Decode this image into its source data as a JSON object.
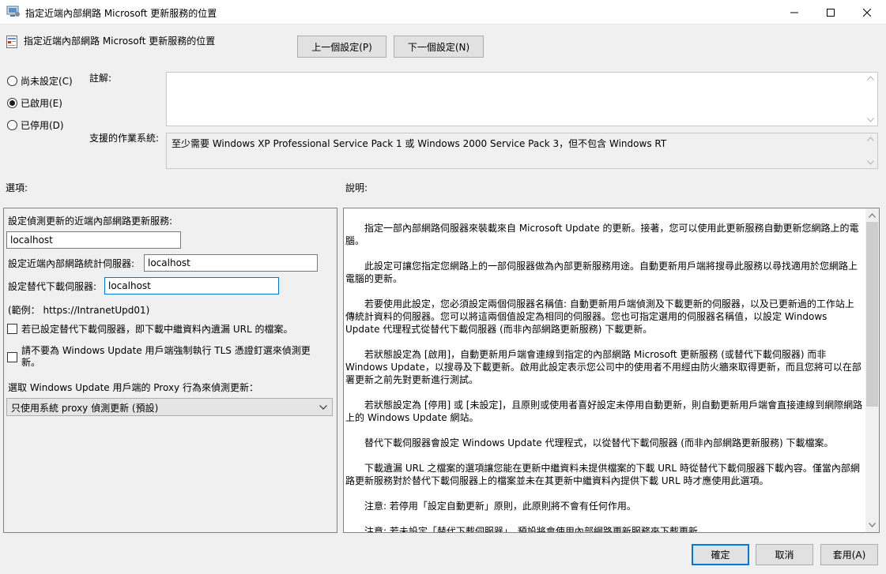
{
  "window": {
    "title": "指定近端內部網路 Microsoft 更新服務的位置"
  },
  "header": {
    "policy_title": "指定近端內部網路 Microsoft 更新服務的位置",
    "prev_label": "上一個設定(P)",
    "next_label": "下一個設定(N)"
  },
  "state": {
    "options": [
      {
        "label": "尚未設定(C)",
        "checked": false
      },
      {
        "label": "已啟用(E)",
        "checked": true
      },
      {
        "label": "已停用(D)",
        "checked": false
      }
    ]
  },
  "comment": {
    "label": "註解:",
    "value": ""
  },
  "supported": {
    "label": "支援的作業系統:",
    "value": "至少需要 Windows XP Professional Service Pack 1 或 Windows 2000 Service Pack 3，但不包含 Windows RT"
  },
  "options_label": "選項:",
  "description_label": "說明:",
  "options_panel": {
    "update_server_label": "設定偵測更新的近端內部網路更新服務:",
    "update_server_value": "localhost",
    "stats_server_label": "設定近端內部網路統計伺服器:",
    "stats_server_value": "localhost",
    "alt_download_label": "設定替代下載伺服器:",
    "alt_download_value": "localhost",
    "example_text": "(範例： https://IntranetUpd01)",
    "checkbox1_label": "若已設定替代下載伺服器，即下載中繼資料內遺漏 URL 的檔案。",
    "checkbox2_label": "請不要為 Windows Update 用戶端強制執行 TLS 憑證釘選來偵測更新。",
    "proxy_label": "選取 Windows Update 用戶端的 Proxy 行為來偵測更新：",
    "proxy_value": "只使用系統 proxy 偵測更新 (預設)"
  },
  "description": {
    "paragraphs": [
      "指定一部內部網路伺服器來裝載來自 Microsoft Update 的更新。接著，您可以使用此更新服務自動更新您網路上的電腦。",
      "此設定可讓您指定您網路上的一部伺服器做為內部更新服務用途。自動更新用戶端將搜尋此服務以尋找適用於您網路上電腦的更新。",
      "若要使用此設定，您必須設定兩個伺服器名稱值: 自動更新用戶端偵測及下載更新的伺服器，以及已更新過的工作站上傳統計資料的伺服器。您可以將這兩個值設定為相同的伺服器。您也可指定選用的伺服器名稱值，以設定 Windows Update 代理程式從替代下載伺服器 (而非內部網路更新服務) 下載更新。",
      "若狀態設定為 [啟用]，自動更新用戶端會連線到指定的內部網路 Microsoft 更新服務 (或替代下載伺服器) 而非 Windows Update，以搜尋及下載更新。啟用此設定表示您公司中的使用者不用經由防火牆來取得更新，而且您將可以在部署更新之前先對更新進行測試。",
      "若狀態設定為 [停用] 或 [未設定]，且原則或使用者喜好設定未停用自動更新，則自動更新用戶端會直接連線到網際網路上的 Windows Update 網站。",
      "替代下載伺服器會設定 Windows Update 代理程式，以從替代下載伺服器 (而非內部網路更新服務) 下載檔案。",
      "下載遺漏 URL 之檔案的選項讓您能在更新中繼資料未提供檔案的下載 URL 時從替代下載伺服器下載內容。僅當內部網路更新服務對於替代下載伺服器上的檔案並未在其更新中繼資料內提供下載 URL 時才應使用此選項。",
      "注意: 若停用「設定自動更新」原則，此原則將不會有任何作用。",
      "注意: 若未設定「替代下載伺服器」，預設將會使用內部網路更新服務來下載更新。"
    ]
  },
  "footer": {
    "ok_label": "確定",
    "cancel_label": "取消",
    "apply_label": "套用(A)"
  }
}
